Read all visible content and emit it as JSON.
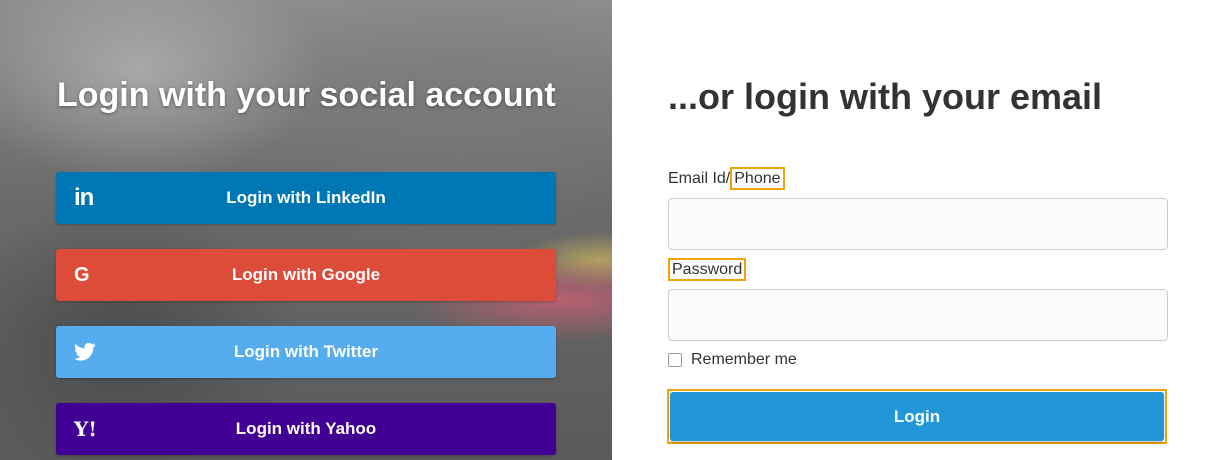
{
  "social": {
    "title": "Login with your social account",
    "buttons": [
      {
        "label": "Login with LinkedIn",
        "icon": "linkedin-icon",
        "color": "#0077b5"
      },
      {
        "label": "Login with Google",
        "icon": "google-icon",
        "color": "#dd4b39"
      },
      {
        "label": "Login with Twitter",
        "icon": "twitter-icon",
        "color": "#55acee"
      },
      {
        "label": "Login with Yahoo",
        "icon": "yahoo-icon",
        "color": "#410093"
      }
    ],
    "icon_glyphs": {
      "linkedin": "in",
      "google": "G",
      "yahoo": "Y!"
    }
  },
  "email_login": {
    "title": "...or login with your email",
    "email_label_prefix": "Email Id/",
    "email_label_highlight": "Phone",
    "email_value": "",
    "password_label": "Password",
    "password_value": "",
    "remember_label": "Remember me",
    "remember_checked": false,
    "login_label": "Login",
    "login_color": "#2196d8",
    "highlight_color": "#f0a30a"
  }
}
